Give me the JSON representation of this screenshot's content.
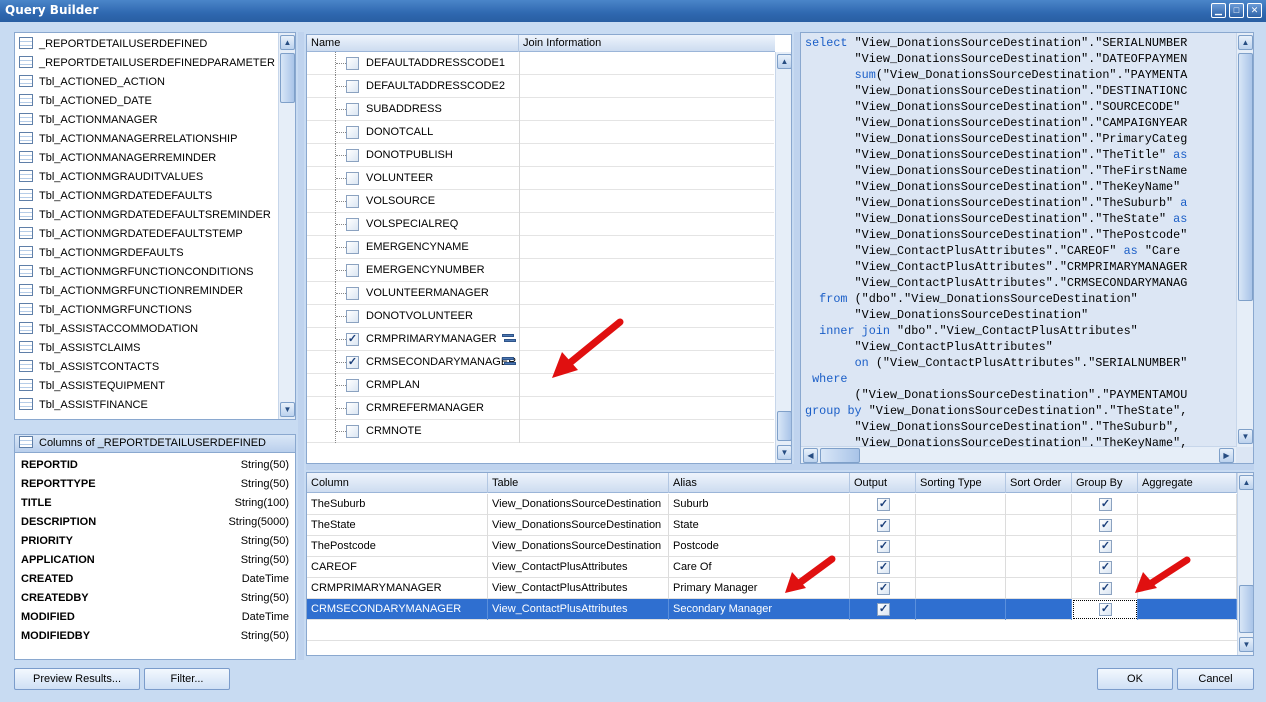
{
  "window": {
    "title": "Query Builder"
  },
  "tables": [
    "_REPORTDETAILUSERDEFINED",
    "_REPORTDETAILUSERDEFINEDPARAMETER",
    "Tbl_ACTIONED_ACTION",
    "Tbl_ACTIONED_DATE",
    "Tbl_ACTIONMANAGER",
    "Tbl_ACTIONMANAGERRELATIONSHIP",
    "Tbl_ACTIONMANAGERREMINDER",
    "Tbl_ACTIONMGRAUDITVALUES",
    "Tbl_ACTIONMGRDATEDEFAULTS",
    "Tbl_ACTIONMGRDATEDEFAULTSREMINDER",
    "Tbl_ACTIONMGRDATEDEFAULTSTEMP",
    "Tbl_ACTIONMGRDEFAULTS",
    "Tbl_ACTIONMGRFUNCTIONCONDITIONS",
    "Tbl_ACTIONMGRFUNCTIONREMINDER",
    "Tbl_ACTIONMGRFUNCTIONS",
    "Tbl_ASSISTACCOMMODATION",
    "Tbl_ASSISTCLAIMS",
    "Tbl_ASSISTCONTACTS",
    "Tbl_ASSISTEQUIPMENT",
    "Tbl_ASSISTFINANCE"
  ],
  "columns_panel": {
    "header": "Columns of _REPORTDETAILUSERDEFINED",
    "columns": [
      {
        "name": "REPORTID",
        "type": "String(50)"
      },
      {
        "name": "REPORTTYPE",
        "type": "String(50)"
      },
      {
        "name": "TITLE",
        "type": "String(100)"
      },
      {
        "name": "DESCRIPTION",
        "type": "String(5000)"
      },
      {
        "name": "PRIORITY",
        "type": "String(50)"
      },
      {
        "name": "APPLICATION",
        "type": "String(50)"
      },
      {
        "name": "CREATED",
        "type": "DateTime"
      },
      {
        "name": "CREATEDBY",
        "type": "String(50)"
      },
      {
        "name": "MODIFIED",
        "type": "DateTime"
      },
      {
        "name": "MODIFIEDBY",
        "type": "String(50)"
      }
    ]
  },
  "field_tree": {
    "headers": {
      "name": "Name",
      "join": "Join Information"
    },
    "fields": [
      {
        "name": "DEFAULTADDRESSCODE1",
        "checked": false,
        "relation": false
      },
      {
        "name": "DEFAULTADDRESSCODE2",
        "checked": false,
        "relation": false
      },
      {
        "name": "SUBADDRESS",
        "checked": false,
        "relation": false
      },
      {
        "name": "DONOTCALL",
        "checked": false,
        "relation": false
      },
      {
        "name": "DONOTPUBLISH",
        "checked": false,
        "relation": false
      },
      {
        "name": "VOLUNTEER",
        "checked": false,
        "relation": false
      },
      {
        "name": "VOLSOURCE",
        "checked": false,
        "relation": false
      },
      {
        "name": "VOLSPECIALREQ",
        "checked": false,
        "relation": false
      },
      {
        "name": "EMERGENCYNAME",
        "checked": false,
        "relation": false
      },
      {
        "name": "EMERGENCYNUMBER",
        "checked": false,
        "relation": false
      },
      {
        "name": "VOLUNTEERMANAGER",
        "checked": false,
        "relation": false
      },
      {
        "name": "DONOTVOLUNTEER",
        "checked": false,
        "relation": false
      },
      {
        "name": "CRMPRIMARYMANAGER",
        "checked": true,
        "relation": true
      },
      {
        "name": "CRMSECONDARYMANAGER",
        "checked": true,
        "relation": true
      },
      {
        "name": "CRMPLAN",
        "checked": false,
        "relation": false
      },
      {
        "name": "CRMREFERMANAGER",
        "checked": false,
        "relation": false
      },
      {
        "name": "CRMNOTE",
        "checked": false,
        "relation": false
      }
    ]
  },
  "sql_lines": [
    [
      [
        "kw",
        "select "
      ],
      [
        "t",
        "\"View_DonationsSourceDestination\".\"SERIALNUMBER"
      ]
    ],
    [
      [
        "t",
        "       \"View_DonationsSourceDestination\".\"DATEOFPAYMEN"
      ]
    ],
    [
      [
        "t",
        "       "
      ],
      [
        "kw",
        "sum"
      ],
      [
        "t",
        "(\"View_DonationsSourceDestination\".\"PAYMENTA"
      ]
    ],
    [
      [
        "t",
        "       \"View_DonationsSourceDestination\".\"DESTINATIONC"
      ]
    ],
    [
      [
        "t",
        "       \"View_DonationsSourceDestination\".\"SOURCECODE\""
      ]
    ],
    [
      [
        "t",
        "       \"View_DonationsSourceDestination\".\"CAMPAIGNYEAR"
      ]
    ],
    [
      [
        "t",
        "       \"View_DonationsSourceDestination\".\"PrimaryCateg"
      ]
    ],
    [
      [
        "t",
        "       \"View_DonationsSourceDestination\".\"TheTitle\" "
      ],
      [
        "kw",
        "as"
      ]
    ],
    [
      [
        "t",
        "       \"View_DonationsSourceDestination\".\"TheFirstName"
      ]
    ],
    [
      [
        "t",
        "       \"View_DonationsSourceDestination\".\"TheKeyName\""
      ]
    ],
    [
      [
        "t",
        "       \"View_DonationsSourceDestination\".\"TheSuburb\" "
      ],
      [
        "kw",
        "a"
      ]
    ],
    [
      [
        "t",
        "       \"View_DonationsSourceDestination\".\"TheState\" "
      ],
      [
        "kw",
        "as"
      ]
    ],
    [
      [
        "t",
        "       \"View_DonationsSourceDestination\".\"ThePostcode\""
      ]
    ],
    [
      [
        "t",
        "       \"View_ContactPlusAttributes\".\"CAREOF\" "
      ],
      [
        "kw",
        "as"
      ],
      [
        "t",
        " \"Care"
      ]
    ],
    [
      [
        "t",
        "       \"View_ContactPlusAttributes\".\"CRMPRIMARYMANAGER"
      ]
    ],
    [
      [
        "t",
        "       \"View_ContactPlusAttributes\".\"CRMSECONDARYMANAG"
      ]
    ],
    [
      [
        "t",
        "  "
      ],
      [
        "kw",
        "from"
      ],
      [
        "t",
        " (\"dbo\".\"View_DonationsSourceDestination\""
      ]
    ],
    [
      [
        "t",
        "       \"View_DonationsSourceDestination\""
      ]
    ],
    [
      [
        "t",
        "  "
      ],
      [
        "kw",
        "inner join"
      ],
      [
        "t",
        " \"dbo\".\"View_ContactPlusAttributes\""
      ]
    ],
    [
      [
        "t",
        "       \"View_ContactPlusAttributes\""
      ]
    ],
    [
      [
        "t",
        "       "
      ],
      [
        "kw",
        "on"
      ],
      [
        "t",
        " (\"View_ContactPlusAttributes\".\"SERIALNUMBER\""
      ]
    ],
    [
      [
        "t",
        " "
      ],
      [
        "kw",
        "where"
      ]
    ],
    [
      [
        "t",
        "       (\"View_DonationsSourceDestination\".\"PAYMENTAMOU"
      ]
    ],
    [
      [
        "kw",
        "group by"
      ],
      [
        "t",
        " \"View_DonationsSourceDestination\".\"TheState\","
      ]
    ],
    [
      [
        "t",
        "       \"View_DonationsSourceDestination\".\"TheSuburb\","
      ]
    ],
    [
      [
        "t",
        "       \"View_DonationsSourceDestination\".\"TheKeyName\","
      ]
    ]
  ],
  "grid": {
    "headers": [
      "Column",
      "Table",
      "Alias",
      "Output",
      "Sorting Type",
      "Sort Order",
      "Group By",
      "Aggregate"
    ],
    "rows": [
      {
        "column": "TheSuburb",
        "table": "View_DonationsSourceDestination",
        "alias": "Suburb",
        "output": true,
        "group_by": true,
        "selected": false
      },
      {
        "column": "TheState",
        "table": "View_DonationsSourceDestination",
        "alias": "State",
        "output": true,
        "group_by": true,
        "selected": false
      },
      {
        "column": "ThePostcode",
        "table": "View_DonationsSourceDestination",
        "alias": "Postcode",
        "output": true,
        "group_by": true,
        "selected": false
      },
      {
        "column": "CAREOF",
        "table": "View_ContactPlusAttributes",
        "alias": "Care Of",
        "output": true,
        "group_by": true,
        "selected": false
      },
      {
        "column": "CRMPRIMARYMANAGER",
        "table": "View_ContactPlusAttributes",
        "alias": "Primary Manager",
        "output": true,
        "group_by": true,
        "selected": false
      },
      {
        "column": "CRMSECONDARYMANAGER",
        "table": "View_ContactPlusAttributes",
        "alias": "Secondary Manager",
        "output": true,
        "group_by": true,
        "selected": true
      }
    ]
  },
  "buttons": {
    "preview": "Preview Results...",
    "filter": "Filter...",
    "ok": "OK",
    "cancel": "Cancel"
  },
  "colors": {
    "accent": "#2f6fd0",
    "arrow": "#e01010",
    "sql_bg": "#dce6f4"
  }
}
